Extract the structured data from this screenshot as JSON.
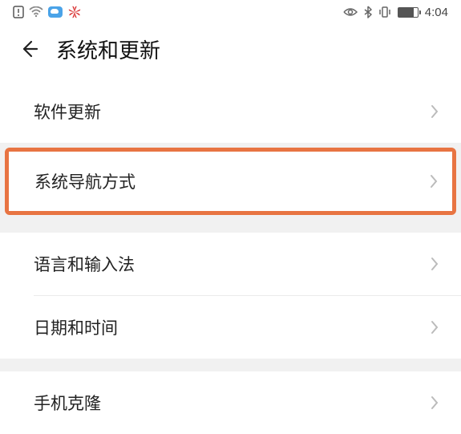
{
  "statusBar": {
    "time": "4:04"
  },
  "header": {
    "title": "系统和更新"
  },
  "items": {
    "softwareUpdate": "软件更新",
    "systemNavigation": "系统导航方式",
    "languageInput": "语言和输入法",
    "dateTime": "日期和时间",
    "phoneClone": "手机克隆"
  }
}
